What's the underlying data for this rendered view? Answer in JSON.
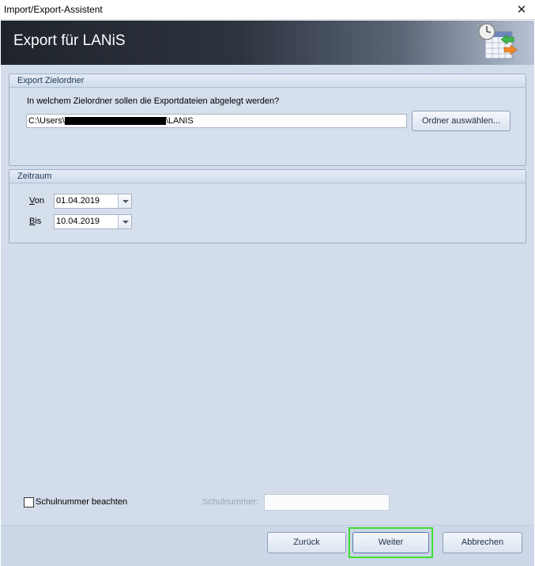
{
  "window": {
    "title": "Import/Export-Assistent",
    "close_glyph": "✕"
  },
  "banner": {
    "heading": "Export für LANiS",
    "icon": "calendar-export-icon"
  },
  "export_group": {
    "title": "Export Zielordner",
    "question": "In welchem Zielordner sollen die Exportdateien abgelegt werden?",
    "path_prefix": "C:\\Users\\",
    "path_suffix": "\\LANIS",
    "choose_button": "Ordner auswählen..."
  },
  "period_group": {
    "title": "Zeitraum",
    "from_label_underline": "V",
    "from_label_rest": "on",
    "from_value": "01.04.2019",
    "to_label_underline": "B",
    "to_label_rest": "is",
    "to_value": "10.04.2019"
  },
  "school": {
    "checkbox_label": "Schulnummer beachten",
    "checked": false,
    "number_label": "Schulnummer:",
    "number_value": ""
  },
  "footer": {
    "back_button": "Zurück",
    "next_button": "Weiter",
    "cancel_button": "Abbrechen"
  },
  "colors": {
    "highlight": "#3ce032",
    "panel": "#d3dcea"
  }
}
